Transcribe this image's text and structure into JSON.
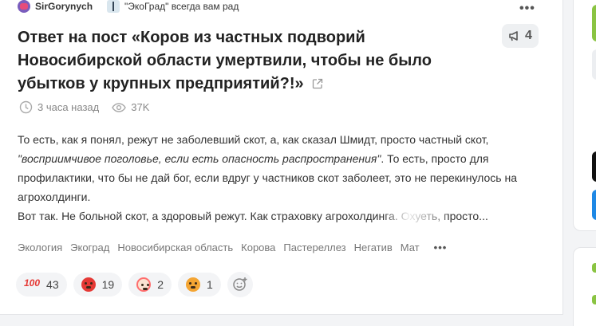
{
  "post": {
    "author": "SirGorynych",
    "community": "\"ЭкоГрад\" всегда вам рад",
    "title": "Ответ на пост «Коров из частных подворий Новосибирской области умертвили, чтобы не было убытков у крупных предприятий?!»",
    "repost_count": "4",
    "time_ago": "3 часа назад",
    "views": "37K",
    "body": {
      "line1": "То есть, как я понял, режут не заболевший скот, а, как сказал Шмидт, просто частный скот,",
      "quote": "\"восприимчивое поголовье, если есть опасность распространения\"",
      "line2_rest": ". То есть, просто для профилактики, что бы не дай бог, если вдруг у частников скот заболеет, это не перекинулось на агрохолдинги.",
      "line3": "Вот так. Не больной скот, а здоровый режут. Как страховку агрохолдинга. Охуеть, просто..."
    },
    "tags": [
      "Экология",
      "Экоград",
      "Новосибирская область",
      "Корова",
      "Пастереллез",
      "Негатив",
      "Мат"
    ],
    "reactions": [
      {
        "name": "100",
        "count": "43"
      },
      {
        "name": "angry",
        "count": "19"
      },
      {
        "name": "clown",
        "count": "2"
      },
      {
        "name": "scared",
        "count": "1"
      }
    ]
  },
  "icons": {
    "more": "more-dots-icon",
    "external": "external-link-icon",
    "repost": "megaphone-icon",
    "time": "clock-icon",
    "views": "eye-icon",
    "add_reaction": "add-emoji-icon"
  },
  "colors": {
    "accent_green": "#8ac442",
    "angry": "#e53935",
    "blue": "#1e88e5"
  }
}
